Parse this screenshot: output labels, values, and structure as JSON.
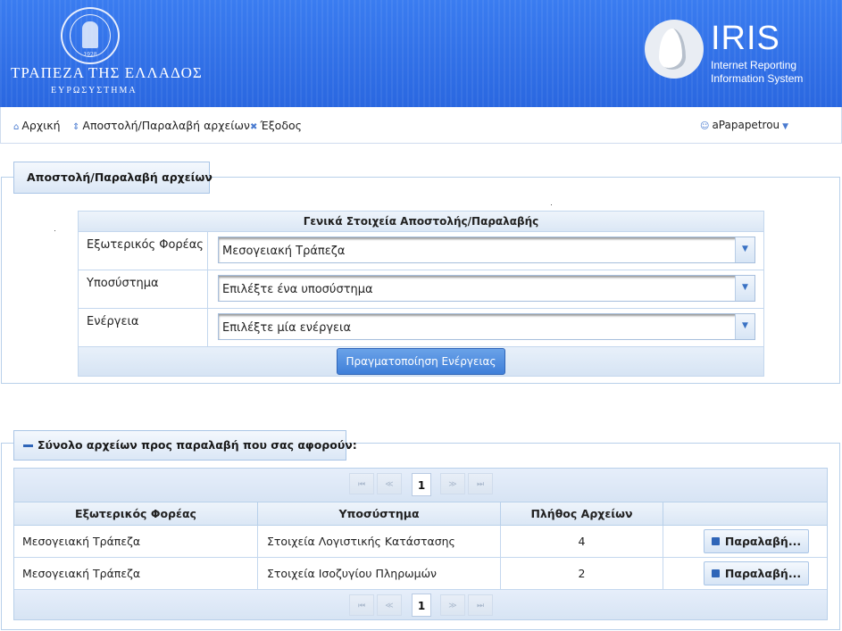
{
  "header": {
    "bank_name": "ΤΡΑΠΕΖΑ ΤΗΣ ΕΛΛΑΔΟΣ",
    "bank_sub": "ΕΥΡΩΣΥΣΤΗΜΑ",
    "emblem_year": "1928",
    "brand_title": "IRIS",
    "brand_sub1": "Internet Reporting",
    "brand_sub2": "Information System",
    "colors": {
      "banner": "#2f6fe8",
      "accent": "#3f7fd9"
    }
  },
  "nav": {
    "items": [
      {
        "label": "Αρχική",
        "icon": "home-icon"
      },
      {
        "label": "Αποστολή/Παραλαβή αρχείων",
        "icon": "updown-icon"
      },
      {
        "label": "Έξοδος",
        "icon": "close-icon"
      }
    ],
    "user": {
      "label": "aPapapetrou",
      "icon": "user-icon"
    }
  },
  "send_receive": {
    "legend": "Αποστολή/Παραλαβή αρχείων",
    "table_title": "Γενικά Στοιχεία Αποστολής/Παραλαβής",
    "rows": [
      {
        "label": "Εξωτερικός Φορέας",
        "value": "Μεσογειακή Τράπεζα"
      },
      {
        "label": "Υποσύστημα",
        "value": "Επιλέξτε ένα υποσύστημα"
      },
      {
        "label": "Ενέργεια",
        "value": "Επιλέξτε μία ενέργεια"
      }
    ],
    "action_button": "Πραγματοποίηση Ενέργειας"
  },
  "files": {
    "legend": "Σύνολο αρχείων προς παραλαβή που σας αφορούν:",
    "pager": {
      "first": "⏮",
      "prev": "≪",
      "current": "1",
      "next": "≫",
      "last": "⏭"
    },
    "columns": [
      "Εξωτερικός Φορέας",
      "Υποσύστημα",
      "Πλήθος Αρχείων",
      ""
    ],
    "rows": [
      {
        "entity": "Μεσογειακή Τράπεζα",
        "subsystem": "Στοιχεία Λογιστικής Κατάστασης",
        "count": "4",
        "action": "Παραλαβή..."
      },
      {
        "entity": "Μεσογειακή Τράπεζα",
        "subsystem": "Στοιχεία Ισοζυγίου Πληρωμών",
        "count": "2",
        "action": "Παραλαβή..."
      }
    ]
  }
}
